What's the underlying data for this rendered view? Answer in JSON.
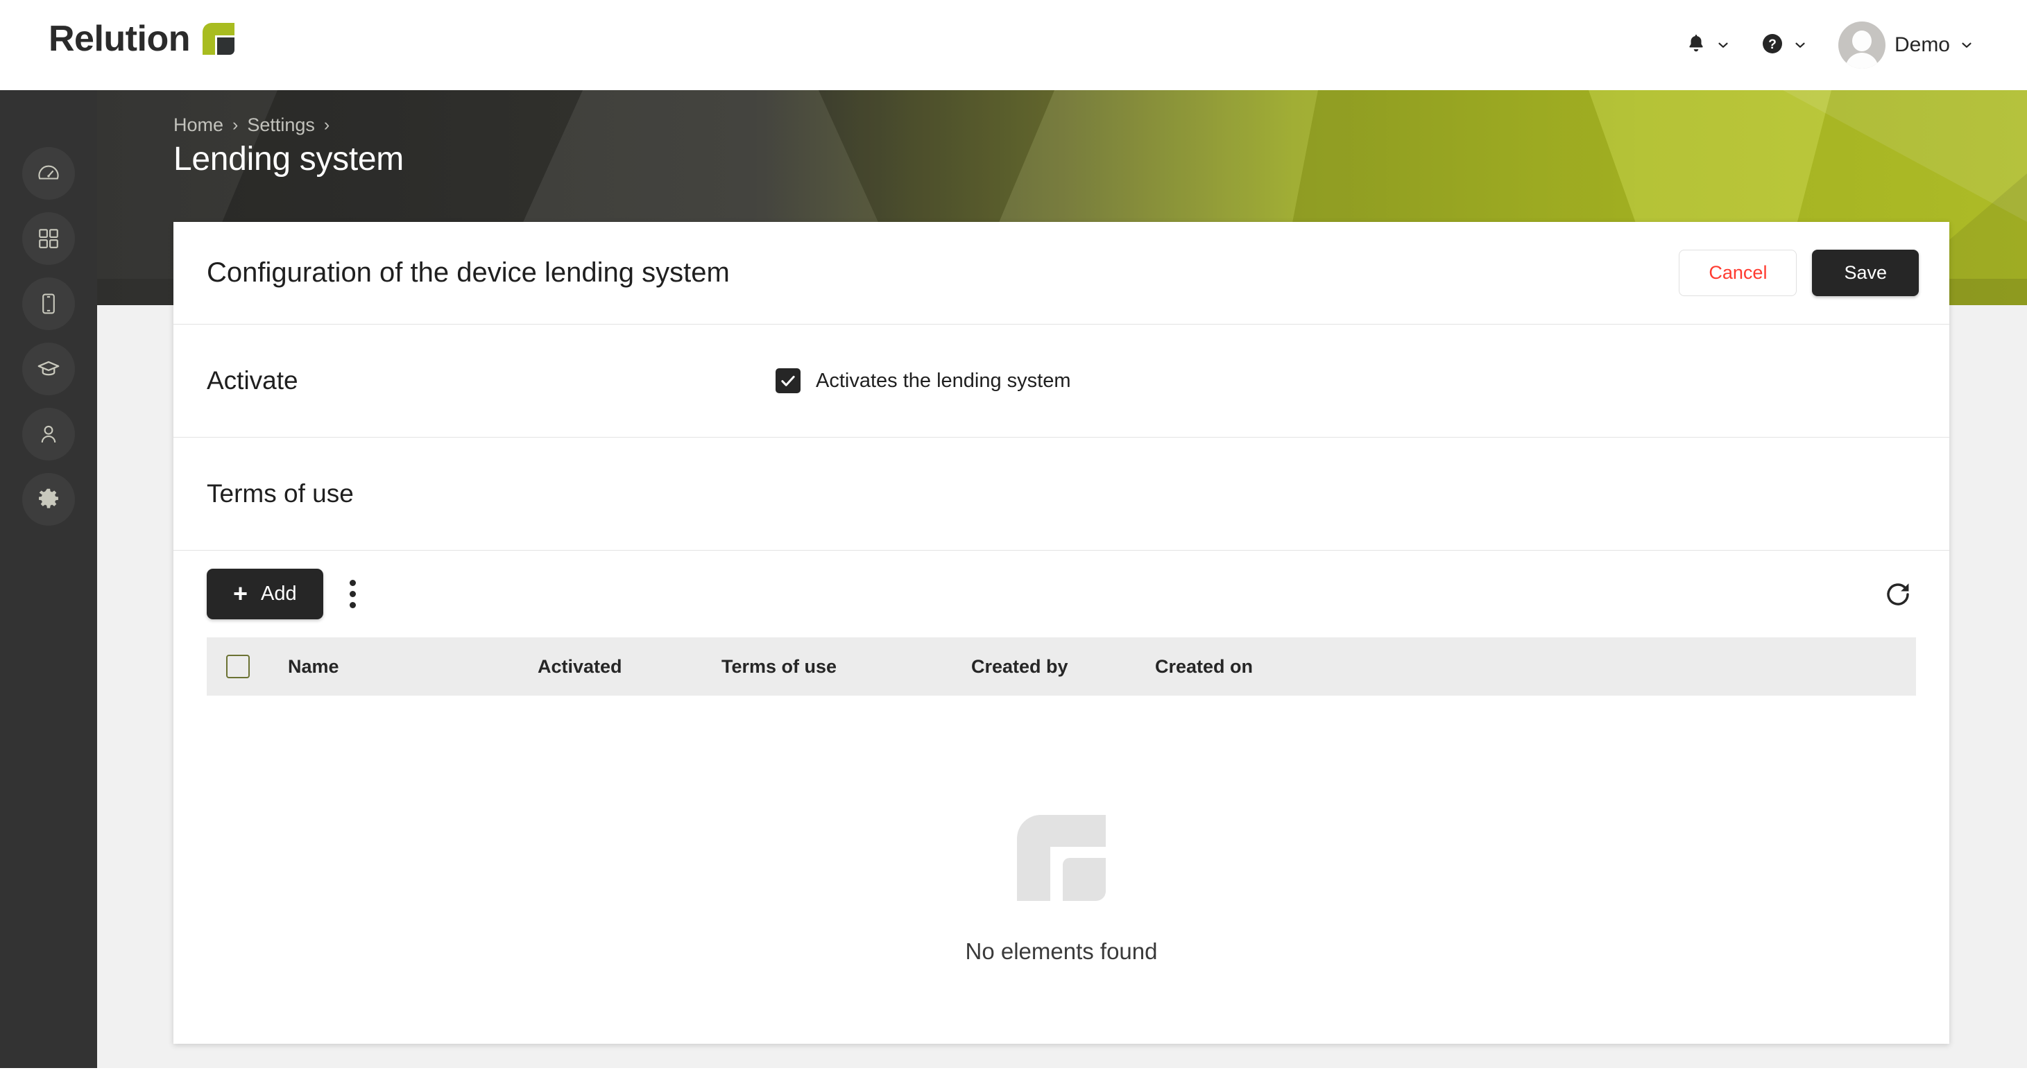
{
  "app": {
    "logo_text": "Relution",
    "brand_green": "#a8bc20",
    "brand_dark": "#2f3233"
  },
  "topbar": {
    "notifications_icon": "bell-icon",
    "help_icon": "question-circle-icon",
    "chevron_icon": "chevron-down-icon",
    "user_name": "Demo",
    "avatar_icon": "avatar"
  },
  "sidebar": {
    "items": [
      {
        "name": "dashboard",
        "icon": "gauge-icon"
      },
      {
        "name": "apps",
        "icon": "grid-icon"
      },
      {
        "name": "devices",
        "icon": "mobile-icon"
      },
      {
        "name": "education",
        "icon": "graduation-cap-icon"
      },
      {
        "name": "users",
        "icon": "user-icon"
      },
      {
        "name": "settings",
        "icon": "gear-icon"
      }
    ]
  },
  "header": {
    "breadcrumb": [
      "Home",
      "Settings"
    ],
    "separator": "›",
    "title": "Lending system"
  },
  "card": {
    "title": "Configuration of the device lending system",
    "cancel_label": "Cancel",
    "save_label": "Save",
    "cancel_color": "#ff3b30",
    "save_bg": "#262626"
  },
  "activate": {
    "section_label": "Activate",
    "checkbox_label": "Activates the lending system",
    "checked": true
  },
  "terms": {
    "section_label": "Terms of use"
  },
  "toolbar": {
    "add_label": "Add",
    "add_plus": "+",
    "more_icon": "kebab-menu-icon",
    "refresh_icon": "refresh-icon"
  },
  "table": {
    "columns": [
      "Name",
      "Activated",
      "Terms of use",
      "Created by",
      "Created on"
    ],
    "select_all_checked": false,
    "rows": [],
    "empty_message": "No elements found",
    "empty_icon": "relution-mark-icon"
  }
}
